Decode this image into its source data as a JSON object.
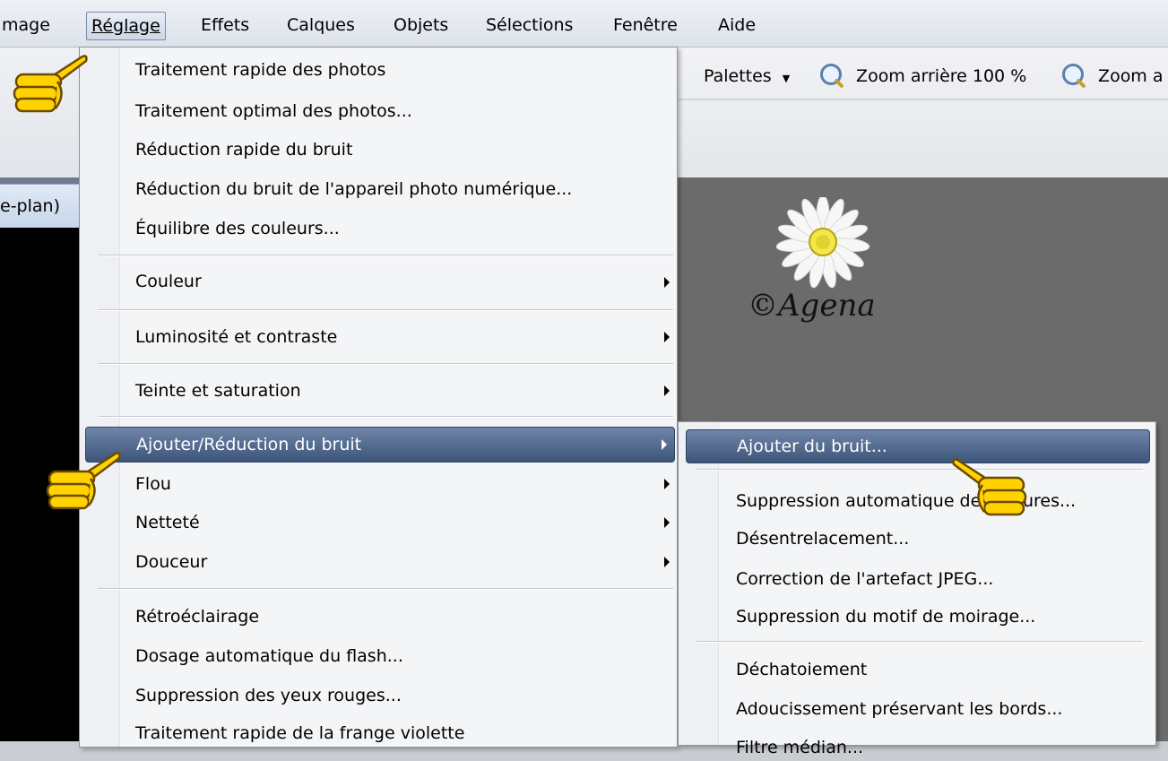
{
  "menubar": {
    "items": [
      {
        "label": "mage",
        "ul": ""
      },
      {
        "label": "Réglage",
        "ul": "R"
      },
      {
        "label": "Effets",
        "ul": "t"
      },
      {
        "label": "Calques",
        "ul": "q"
      },
      {
        "label": "Objets",
        "ul": "j"
      },
      {
        "label": "Sélections",
        "ul": "S"
      },
      {
        "label": "Fenêtre",
        "ul": "n"
      },
      {
        "label": "Aide",
        "ul": "A"
      }
    ]
  },
  "toolbar": {
    "palettes_label": "Palettes",
    "zoom_out_label": "Zoom arrière 100 %",
    "zoom_in_label": "Zoom a"
  },
  "workspace": {
    "tab_label": "e-plan)"
  },
  "watermark": {
    "text": "©Agena"
  },
  "menu": {
    "items": [
      "Traitement rapide des photos",
      "Traitement optimal des photos...",
      "Réduction rapide du bruit",
      "Réduction du bruit de l'appareil photo numérique...",
      "Équilibre des couleurs...",
      "Couleur",
      "Luminosité et contraste",
      "Teinte et saturation",
      "Ajouter/Réduction du bruit",
      "Flou",
      "Netteté",
      "Douceur",
      "Rétroéclairage",
      "Dosage automatique du flash...",
      "Suppression des yeux rouges...",
      "Traitement rapide de la frange violette"
    ]
  },
  "submenu": {
    "items": [
      "Ajouter du bruit...",
      "Suppression automatique des rayures...",
      "Désentrelacement...",
      "Correction de l'artefact JPEG...",
      "Suppression du motif de moirage...",
      "Déchatoiement",
      "Adoucissement préservant les bords...",
      "Filtre médian..."
    ]
  },
  "colors": {
    "highlight": "#4d6589",
    "canvas": "#6b6b6b",
    "hand": "#ffd200"
  }
}
